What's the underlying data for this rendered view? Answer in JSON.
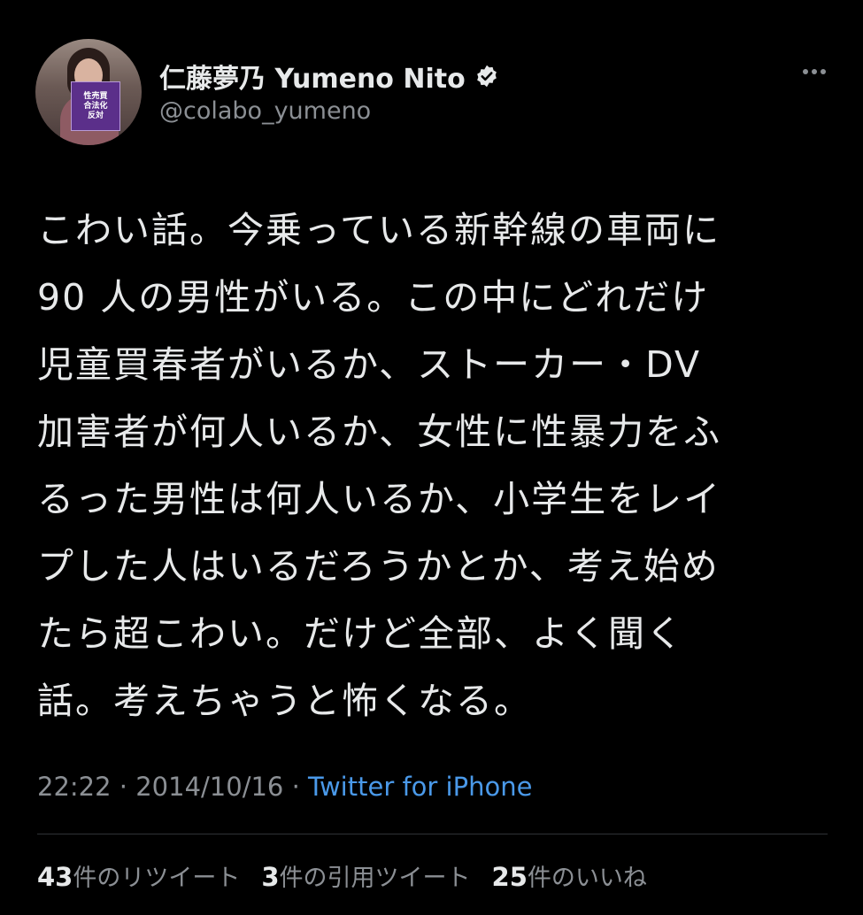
{
  "author": {
    "display_name": "仁藤夢乃 Yumeno Nito",
    "handle": "@colabo_yumeno",
    "avatar_sign_lines": [
      "性売買",
      "合法化",
      "反対"
    ]
  },
  "icons": {
    "verified": "verified-badge-icon",
    "more": "more-options-icon"
  },
  "tweet": {
    "lines": [
      "こわい話。今乗っている新幹線の車両に",
      "90 人の男性がいる。この中にどれだけ",
      "児童買春者がいるか、ストーカー・DV",
      "加害者が何人いるか、女性に性暴力をふ",
      "るった男性は何人いるか、小学生をレイ",
      "プした人はいるだろうかとか、考え始め",
      "たら超こわい。だけど全部、よく聞く",
      "話。考えちゃうと怖くなる。"
    ],
    "time": "22:22",
    "separator": "·",
    "date": "2014/10/16",
    "source": "Twitter for iPhone"
  },
  "stats": {
    "retweets_count": "43",
    "retweets_label": "件のリツイート",
    "quotes_count": "3",
    "quotes_label": "件の引用ツイート",
    "likes_count": "25",
    "likes_label": "件のいいね"
  },
  "colors": {
    "background": "#000000",
    "text": "#e7e9ea",
    "secondary": "#8b8f94",
    "link": "#4a99e9"
  }
}
